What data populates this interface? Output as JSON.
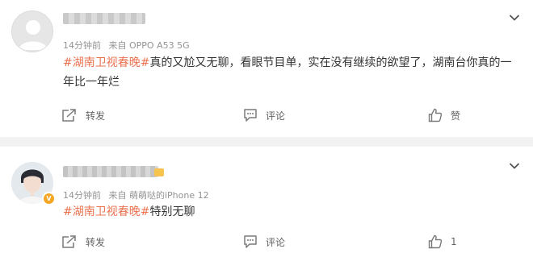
{
  "posts": [
    {
      "time": "14分钟前",
      "source": "来自 OPPO A53 5G",
      "hashtag": "#湖南卫视春晚#",
      "text": "真的又尬又无聊，看眼节目单，实在没有继续的欲望了，湖南台你真的一年比一年烂",
      "actions": {
        "repost_label": "转发",
        "comment_label": "评论",
        "like_label": "赞"
      }
    },
    {
      "time": "14分钟前",
      "source": "来自 萌萌哒的iPhone 12",
      "hashtag": "#湖南卫视春晚#",
      "text": "特别无聊",
      "actions": {
        "repost_label": "转发",
        "comment_label": "评论",
        "like_count": "1"
      }
    }
  ],
  "colors": {
    "hashtag": "#eb7350",
    "meta": "#939393",
    "divider": "#f2f2f2",
    "vip_badge": "#f5a623"
  },
  "icons": {
    "menu": "chevron-down-icon",
    "repost": "repost-icon",
    "comment": "comment-icon",
    "like": "thumbs-up-icon",
    "vip": "vip-badge-icon"
  }
}
